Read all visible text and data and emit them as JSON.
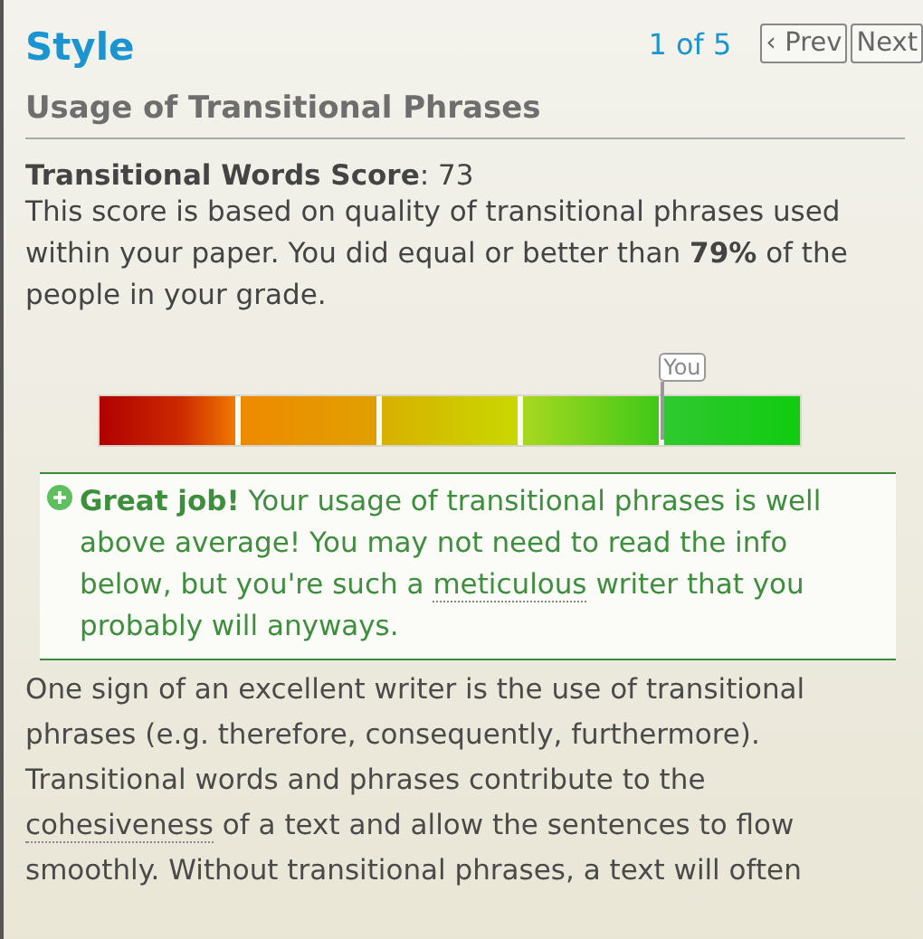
{
  "header": {
    "title": "Style",
    "page_indicator": "1 of 5",
    "buttons": [
      {
        "label": "‹ Prev"
      },
      {
        "label": "Next"
      }
    ]
  },
  "section": {
    "heading": "Usage of Transitional Phrases"
  },
  "score": {
    "label": "**Transitional Words Score**: 73",
    "description": "This score is based on quality of transitional phrases used within your paper. You did equal or better than **79%** of the people in your grade."
  },
  "meter": {
    "level": 0.8,
    "marker_label": "You"
  },
  "feedback": {
    "kind": "positive",
    "parts": [
      {
        "kind": "strong",
        "text": "Great job!"
      },
      {
        "kind": "plain",
        "text": " Your usage of transitional phrases is well above average! You may not need to read the info below, but you're such a "
      },
      {
        "kind": "term",
        "text": "meticulous"
      },
      {
        "kind": "plain",
        "text": " writer that you probably will anyways."
      }
    ]
  },
  "body": {
    "parts": [
      {
        "kind": "plain",
        "text": "One sign of an excellent writer is the use of transitional phrases (e.g. therefore, consequently, furthermore). Transitional words and phrases contribute to the "
      },
      {
        "kind": "term",
        "text": "cohesiveness"
      },
      {
        "kind": "plain",
        "text": " of a text and allow the sentences to flow smoothly. Without transitional phrases, a text will often"
      }
    ]
  }
}
